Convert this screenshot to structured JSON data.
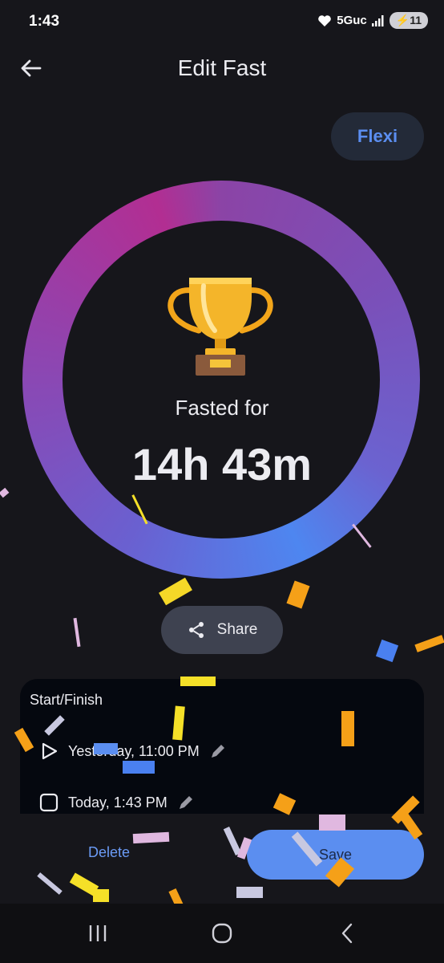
{
  "status_bar": {
    "time": "1:43",
    "network": "5Guc",
    "battery": "11"
  },
  "app_bar": {
    "title": "Edit Fast"
  },
  "plan_badge": "Flexi",
  "progress": {
    "label": "Fasted for",
    "duration": "14h 43m",
    "fraction": 1.0
  },
  "share": {
    "label": "Share"
  },
  "times_card": {
    "title": "Start/Finish",
    "start": "Yesterday, 11:00 PM",
    "finish": "Today, 1:43 PM"
  },
  "actions": {
    "delete": "Delete",
    "save": "Save"
  },
  "colors": {
    "accent": "#5b8ef0",
    "ring_start": "#b22e92",
    "ring_end": "#4e86f0",
    "background": "#16161b"
  },
  "icons": {
    "back": "back-arrow-icon",
    "trophy": "trophy-icon",
    "share": "share-icon",
    "start": "play-icon",
    "finish": "stop-icon",
    "edit": "pencil-icon",
    "nav": [
      "recents-icon",
      "home-icon",
      "nav-back-icon"
    ]
  }
}
